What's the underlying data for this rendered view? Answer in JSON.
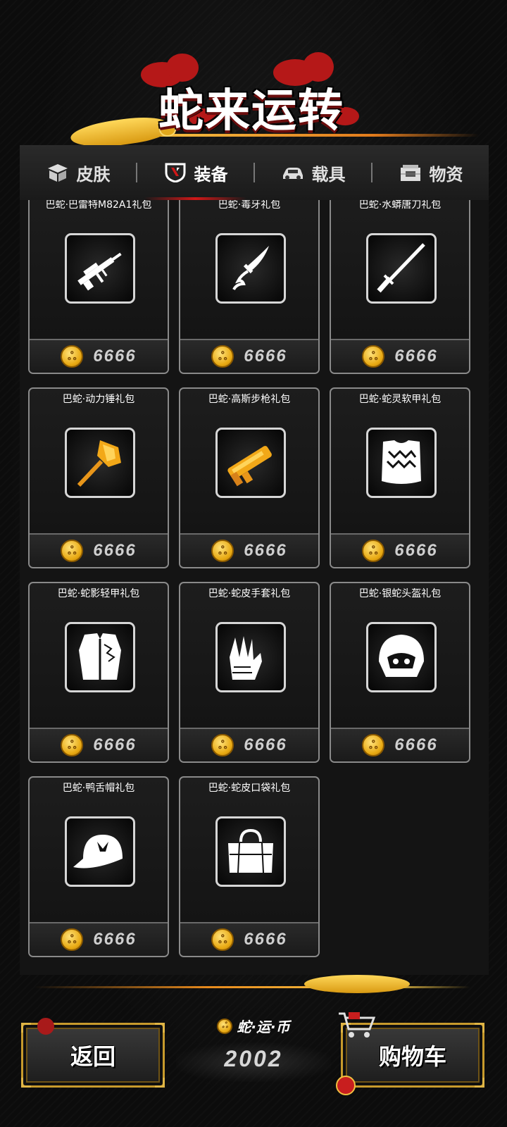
{
  "title": "蛇来运转",
  "tabs": [
    {
      "label": "皮肤",
      "icon": "box-icon",
      "active": false
    },
    {
      "label": "装备",
      "icon": "shield-icon",
      "active": true
    },
    {
      "label": "载具",
      "icon": "car-icon",
      "active": false
    },
    {
      "label": "物资",
      "icon": "crate-icon",
      "active": false
    }
  ],
  "items": [
    {
      "name": "巴蛇·巴雷特M82A1礼包",
      "price": "6666",
      "icon": "sniper-rifle-icon",
      "tint": "white"
    },
    {
      "name": "巴蛇·毒牙礼包",
      "price": "6666",
      "icon": "dagger-icon",
      "tint": "white"
    },
    {
      "name": "巴蛇·水蟒唐刀礼包",
      "price": "6666",
      "icon": "tang-sword-icon",
      "tint": "white"
    },
    {
      "name": "巴蛇·动力锤礼包",
      "price": "6666",
      "icon": "hammer-icon",
      "tint": "gold"
    },
    {
      "name": "巴蛇·高斯步枪礼包",
      "price": "6666",
      "icon": "gauss-rifle-icon",
      "tint": "gold"
    },
    {
      "name": "巴蛇·蛇灵软甲礼包",
      "price": "6666",
      "icon": "soft-armor-icon",
      "tint": "white"
    },
    {
      "name": "巴蛇·蛇影轻甲礼包",
      "price": "6666",
      "icon": "light-armor-icon",
      "tint": "white"
    },
    {
      "name": "巴蛇·蛇皮手套礼包",
      "price": "6666",
      "icon": "gloves-icon",
      "tint": "white"
    },
    {
      "name": "巴蛇·银蛇头盔礼包",
      "price": "6666",
      "icon": "helmet-icon",
      "tint": "white"
    },
    {
      "name": "巴蛇·鸭舌帽礼包",
      "price": "6666",
      "icon": "cap-icon",
      "tint": "white"
    },
    {
      "name": "巴蛇·蛇皮口袋礼包",
      "price": "6666",
      "icon": "bag-icon",
      "tint": "white"
    }
  ],
  "footer": {
    "back_label": "返回",
    "cart_label": "购物车",
    "currency_label": "蛇·运·币",
    "currency_value": "2002"
  },
  "colors": {
    "accent_gold": "#f5c848",
    "accent_red": "#d01818",
    "card_border": "#8a8a8a"
  }
}
